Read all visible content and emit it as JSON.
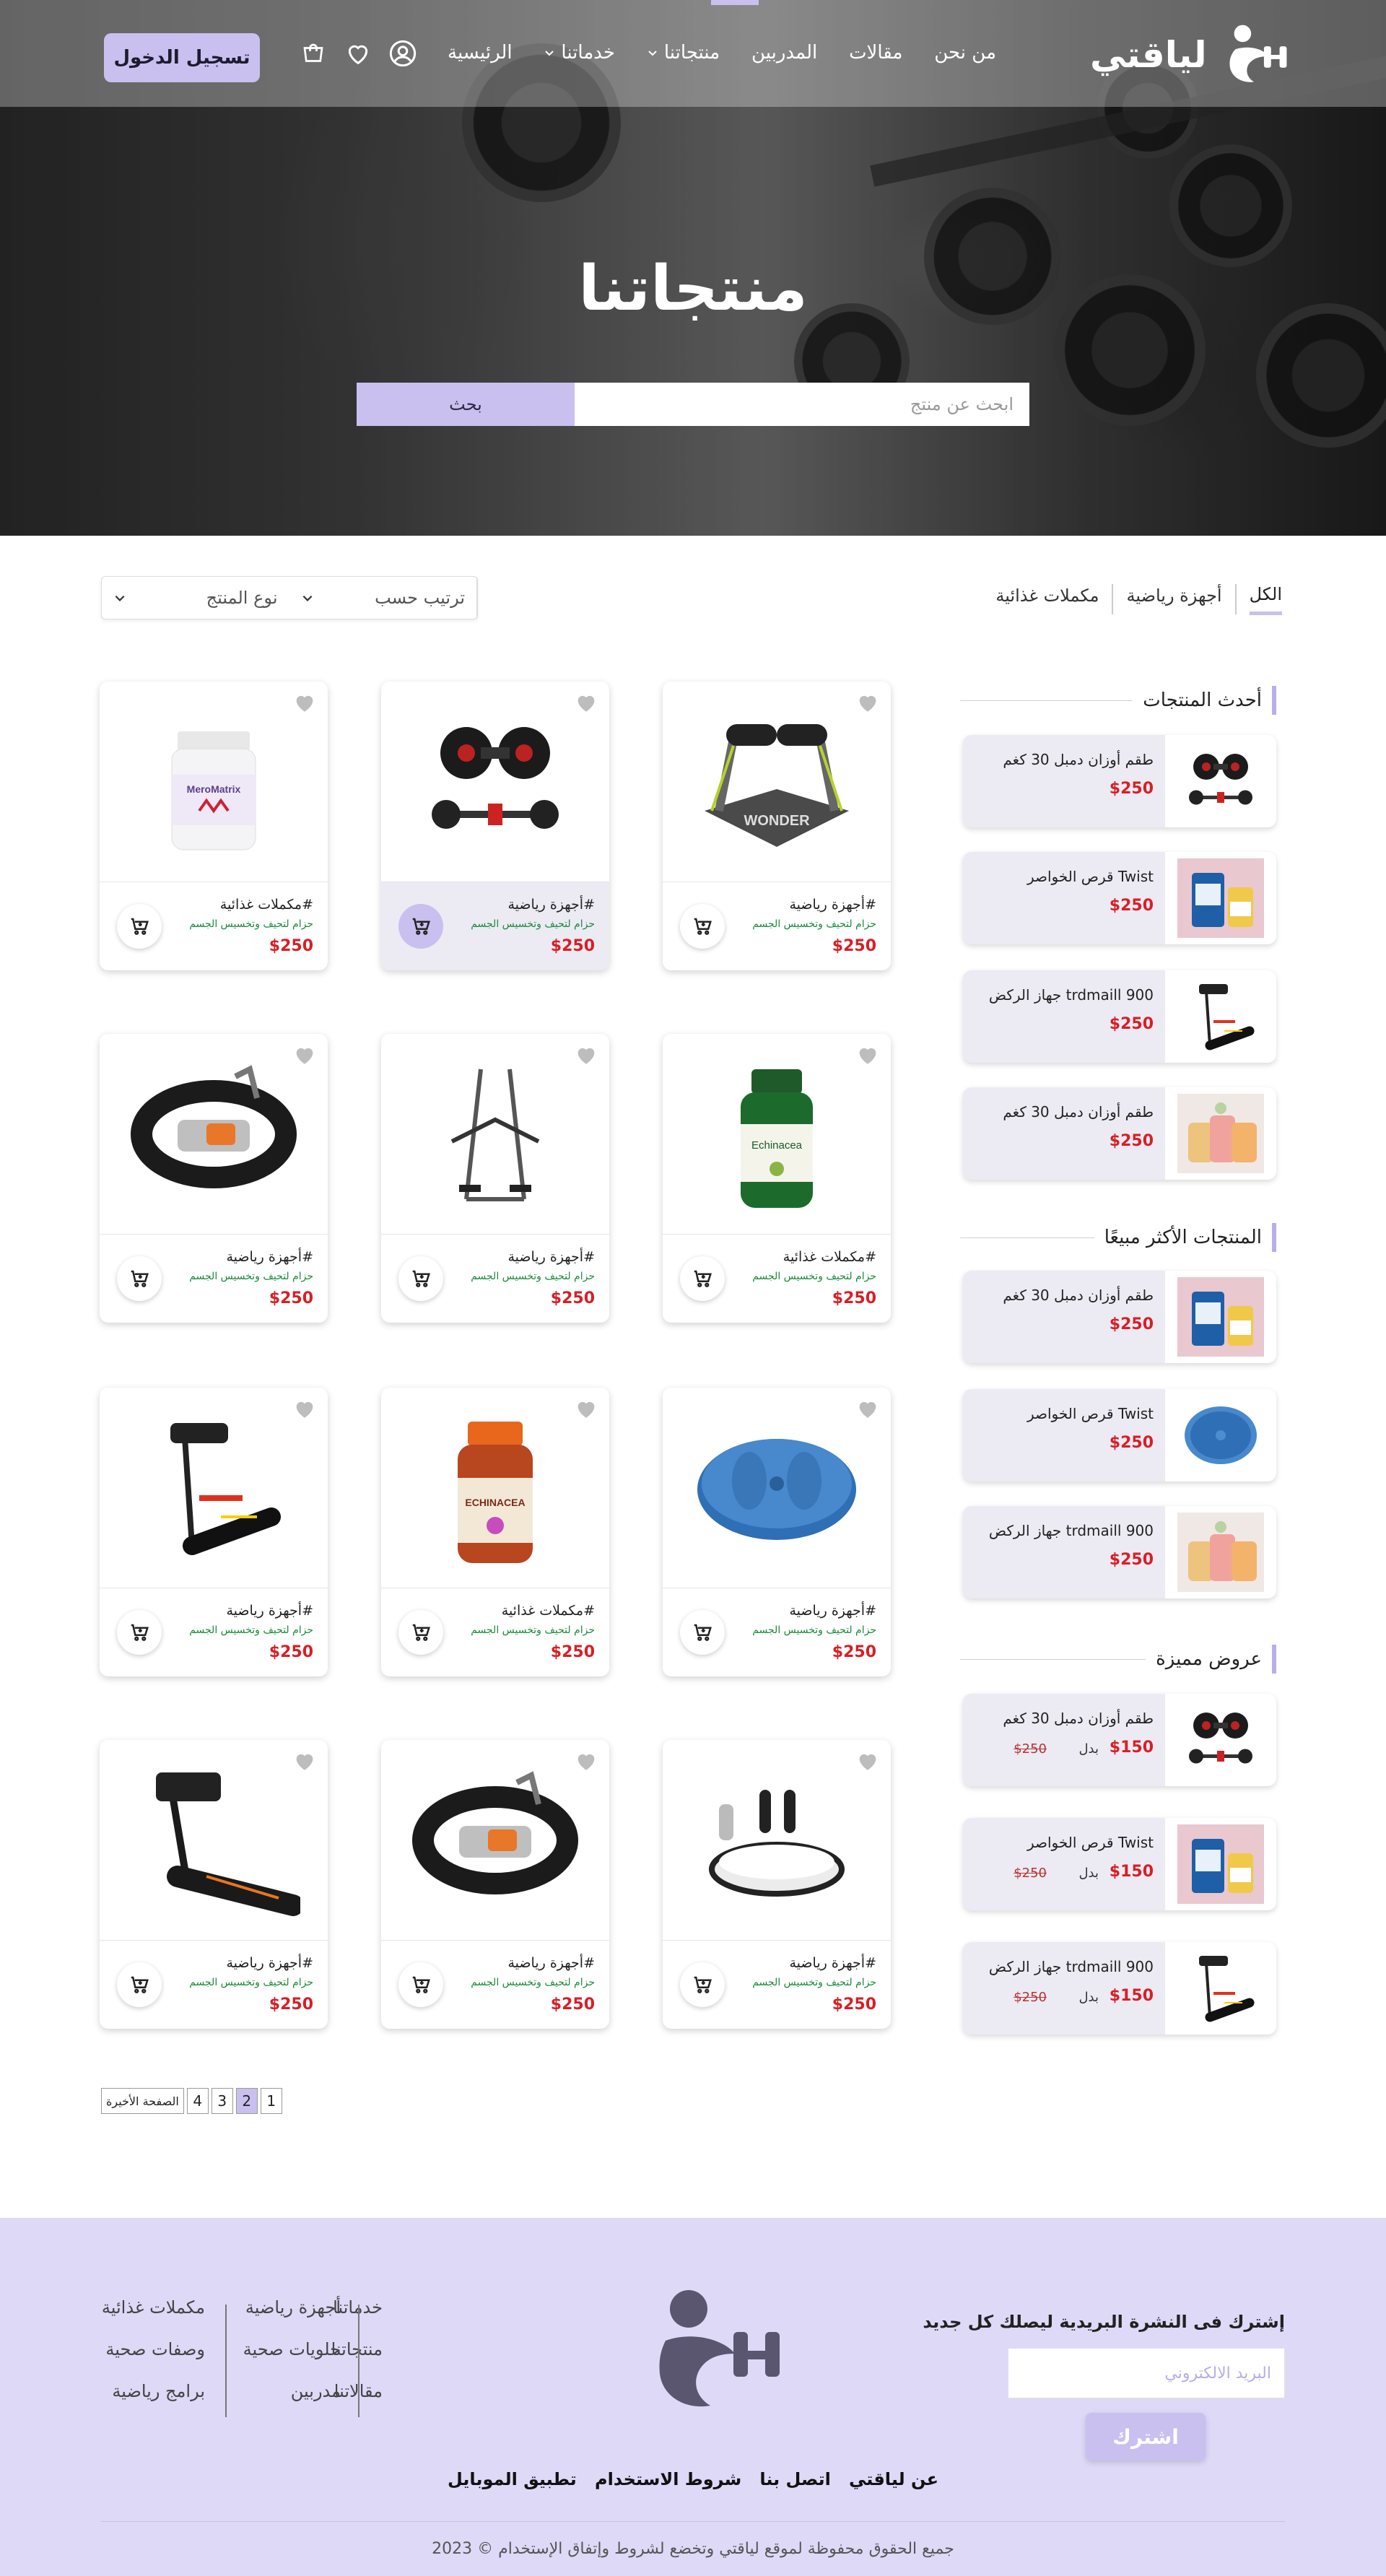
{
  "nav": {
    "logo_text": "لياقتي",
    "menu": [
      {
        "label": "الرئيسية",
        "dropdown": false
      },
      {
        "label": "خدماتنا",
        "dropdown": true
      },
      {
        "label": "منتجاتنا",
        "dropdown": true
      },
      {
        "label": "المدربين",
        "dropdown": false
      },
      {
        "label": "مقالات",
        "dropdown": false
      },
      {
        "label": "من نحن",
        "dropdown": false
      }
    ],
    "login_label": "تسجيل الدخول",
    "icons": [
      "user-icon",
      "heart-icon",
      "cart-icon"
    ]
  },
  "hero": {
    "title": "منتجاتنا",
    "search_placeholder": "ابحث عن منتج",
    "search_button": "بحث"
  },
  "filters": {
    "tabs": [
      "الكل",
      "أجهزة رياضية",
      "مكملات غذائية"
    ],
    "active_tab": "الكل",
    "sort_label": "ترتيب حسب",
    "type_label": "نوع المنتج"
  },
  "sidebar": {
    "latest": {
      "title": "أحدث المنتجات",
      "items": [
        {
          "name": "طقم أوزان دمبل 30 كغم",
          "price": "$250",
          "image": "dumbbell"
        },
        {
          "name": "Twist قرص الخواصر",
          "price": "$250",
          "image": "collagen"
        },
        {
          "name": "trdmaill 900 جهاز الركض",
          "price": "$250",
          "image": "treadmill"
        },
        {
          "name": "طقم أوزان دمبل 30 كغم",
          "price": "$250",
          "image": "gummies"
        }
      ]
    },
    "best": {
      "title": "المنتجات الأكثر مبيعًا",
      "items": [
        {
          "name": "طقم أوزان دمبل 30 كغم",
          "price": "$250",
          "image": "collagen"
        },
        {
          "name": "Twist قرص الخواصر",
          "price": "$250",
          "image": "twist"
        },
        {
          "name": "trdmaill 900 جهاز الركض",
          "price": "$250",
          "image": "gummies"
        }
      ]
    },
    "offers": {
      "title": "عروض مميزة",
      "badal": "بدل",
      "items": [
        {
          "name": "طقم أوزان دمبل 30 كغم",
          "price": "$150",
          "old_price": "$250",
          "image": "dumbbell"
        },
        {
          "name": "Twist قرص الخواصر",
          "price": "$150",
          "old_price": "$250",
          "image": "collagen"
        },
        {
          "name": "trdmaill 900 جهاز الركض",
          "price": "$150",
          "old_price": "$250",
          "image": "treadmill"
        }
      ]
    }
  },
  "products": [
    {
      "category": "#أجهزة رياضية",
      "desc": "حزام لتحيف وتخسيس الجسم",
      "price": "$250",
      "image": "wonder-core",
      "highlight": false
    },
    {
      "category": "#أجهزة رياضية",
      "desc": "حزام لتحيف وتخسيس الجسم",
      "price": "$250",
      "image": "dumbbell",
      "highlight": true
    },
    {
      "category": "#مكملات غذائية",
      "desc": "حزام لتحيف وتخسيس الجسم",
      "price": "$250",
      "image": "supplement-bottle",
      "highlight": false
    },
    {
      "category": "#مكملات غذائية",
      "desc": "حزام لتحيف وتخسيس الجسم",
      "price": "$250",
      "image": "echinacea",
      "highlight": false
    },
    {
      "category": "#أجهزة رياضية",
      "desc": "حزام لتحيف وتخسيس الجسم",
      "price": "$250",
      "image": "air-walker",
      "highlight": false
    },
    {
      "category": "#أجهزة رياضية",
      "desc": "حزام لتحيف وتخسيس الجسم",
      "price": "$250",
      "image": "slimming-belt",
      "highlight": false
    },
    {
      "category": "#أجهزة رياضية",
      "desc": "حزام لتحيف وتخسيس الجسم",
      "price": "$250",
      "image": "twist-disc",
      "highlight": false
    },
    {
      "category": "#مكملات غذائية",
      "desc": "حزام لتحيف وتخسيس الجسم",
      "price": "$250",
      "image": "echinacea-orange",
      "highlight": false
    },
    {
      "category": "#أجهزة رياضية",
      "desc": "حزام لتحيف وتخسيس الجسم",
      "price": "$250",
      "image": "treadmill",
      "highlight": false
    },
    {
      "category": "#أجهزة رياضية",
      "desc": "حزام لتحيف وتخسيس الجسم",
      "price": "$250",
      "image": "vibration-plate",
      "highlight": false
    },
    {
      "category": "#أجهزة رياضية",
      "desc": "حزام لتحيف وتخسيس الجسم",
      "price": "$250",
      "image": "slimming-belt",
      "highlight": false
    },
    {
      "category": "#أجهزة رياضية",
      "desc": "حزام لتحيف وتخسيس الجسم",
      "price": "$250",
      "image": "treadmill-large",
      "highlight": false
    }
  ],
  "pagination": {
    "pages": [
      "1",
      "2",
      "3",
      "4"
    ],
    "active": "2",
    "last_label": "الصفحة الأخيرة"
  },
  "footer": {
    "newsletter_title": "إشترك فى النشرة البريدية ليصلك كل جديد",
    "email_placeholder": "البريد الالكتروني",
    "subscribe_label": "اشترك",
    "col1": [
      "خدماتنا",
      "منتجاتنا",
      "مقالاتنا"
    ],
    "col2": [
      "أجهزة رياضية",
      "حلويات صحية",
      "مدربين"
    ],
    "col3": [
      "مكملات غذائية",
      "وصفات صحية",
      "برامج رياضية"
    ],
    "bottom_links": [
      "عن لياقتي",
      "اتصل بنا",
      "شروط الاستخدام",
      "تطبيق الموبايل"
    ],
    "copyright": "جميع الحقوق محفوظة لموقع لياقتي وتخضع لشروط وإتفاق الإستخدام © 2023"
  },
  "colors": {
    "accent": "#c9c0ef",
    "footer_bg": "#ddd9f7",
    "price": "#d81f26",
    "desc": "#1a8a3a"
  }
}
